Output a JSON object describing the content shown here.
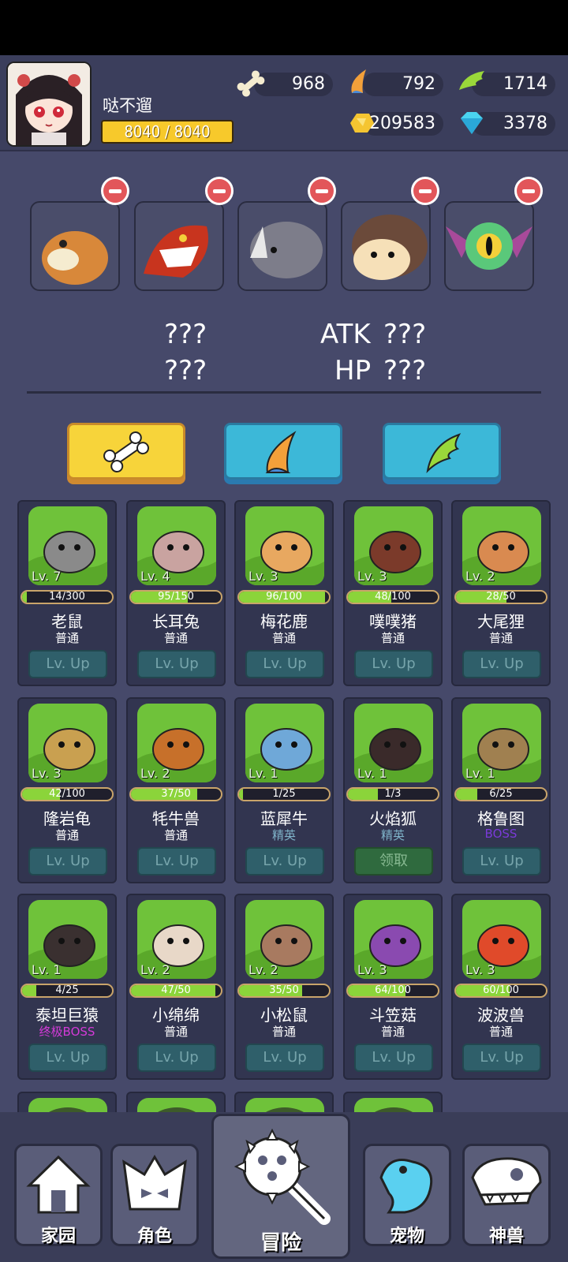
{
  "player": {
    "name": "哒不遛",
    "hp": "8040 / 8040"
  },
  "resources": [
    {
      "icon": "bone-icon",
      "value": "968"
    },
    {
      "icon": "horn-icon",
      "value": "792"
    },
    {
      "icon": "wing-icon",
      "value": "1714"
    },
    {
      "icon": "gold-icon",
      "value": "209583"
    },
    {
      "icon": "diamond-icon",
      "value": "3378"
    }
  ],
  "team": [
    "yak-pet",
    "dragon-pet",
    "rhino-pet",
    "hedgehog-pet",
    "eye-bat-pet"
  ],
  "stats": {
    "left1": "???",
    "left2": "???",
    "atk_label": "ATK",
    "atk": "???",
    "hp_label": "HP",
    "hp": "???"
  },
  "filter_tabs": [
    "bone-icon",
    "horn-icon",
    "wing-icon"
  ],
  "pets": [
    {
      "name": "老鼠",
      "rank": "普通",
      "level": "Lv. 7",
      "xp": "14/300",
      "fill": 0.05,
      "btn": "Lv. Up",
      "rank_color": "#ffffff",
      "bg": "#6fc23a",
      "body": "#8a8a8a"
    },
    {
      "name": "长耳兔",
      "rank": "普通",
      "level": "Lv. 4",
      "xp": "95/150",
      "fill": 0.63,
      "btn": "Lv. Up",
      "rank_color": "#ffffff",
      "bg": "#6fc23a",
      "body": "#c9a3a0"
    },
    {
      "name": "梅花鹿",
      "rank": "普通",
      "level": "Lv. 3",
      "xp": "96/100",
      "fill": 0.96,
      "btn": "Lv. Up",
      "rank_color": "#ffffff",
      "bg": "#6fc23a",
      "body": "#e8a860"
    },
    {
      "name": "噗噗猪",
      "rank": "普通",
      "level": "Lv. 3",
      "xp": "48/100",
      "fill": 0.48,
      "btn": "Lv. Up",
      "rank_color": "#ffffff",
      "bg": "#6fc23a",
      "body": "#7b3a2a"
    },
    {
      "name": "大尾狸",
      "rank": "普通",
      "level": "Lv. 2",
      "xp": "28/50",
      "fill": 0.56,
      "btn": "Lv. Up",
      "rank_color": "#ffffff",
      "bg": "#6fc23a",
      "body": "#d98a50"
    },
    {
      "name": "隆岩龟",
      "rank": "普通",
      "level": "Lv. 3",
      "xp": "42/100",
      "fill": 0.42,
      "btn": "Lv. Up",
      "rank_color": "#ffffff",
      "bg": "#6fc23a",
      "body": "#c9a050"
    },
    {
      "name": "牦牛兽",
      "rank": "普通",
      "level": "Lv. 2",
      "xp": "37/50",
      "fill": 0.74,
      "btn": "Lv. Up",
      "rank_color": "#ffffff",
      "bg": "#6fc23a",
      "body": "#c7702a"
    },
    {
      "name": "蓝犀牛",
      "rank": "精英",
      "level": "Lv. 1",
      "xp": "1/25",
      "fill": 0.04,
      "btn": "Lv. Up",
      "rank_color": "#7fb3c9",
      "bg": "#6fc23a",
      "body": "#6fa8d8"
    },
    {
      "name": "火焰狐",
      "rank": "精英",
      "level": "Lv. 1",
      "xp": "1/3",
      "fill": 0.33,
      "btn": "领取",
      "rank_color": "#7fb3c9",
      "bg": "#6fc23a",
      "body": "#3a2a2a"
    },
    {
      "name": "格鲁图",
      "rank": "BOSS",
      "level": "Lv. 1",
      "xp": "6/25",
      "fill": 0.24,
      "btn": "Lv. Up",
      "rank_color": "#7a3ad8",
      "bg": "#6fc23a",
      "body": "#a08050"
    },
    {
      "name": "泰坦巨猿",
      "rank": "终极BOSS",
      "level": "Lv. 1",
      "xp": "4/25",
      "fill": 0.16,
      "btn": "Lv. Up",
      "rank_color": "#d43ad8",
      "bg": "#6fc23a",
      "body": "#3a3030"
    },
    {
      "name": "小绵绵",
      "rank": "普通",
      "level": "Lv. 2",
      "xp": "47/50",
      "fill": 0.94,
      "btn": "Lv. Up",
      "rank_color": "#ffffff",
      "bg": "#6fc23a",
      "body": "#e8d8c8"
    },
    {
      "name": "小松鼠",
      "rank": "普通",
      "level": "Lv. 2",
      "xp": "35/50",
      "fill": 0.7,
      "btn": "Lv. Up",
      "rank_color": "#ffffff",
      "bg": "#6fc23a",
      "body": "#a87a60"
    },
    {
      "name": "斗笠菇",
      "rank": "普通",
      "level": "Lv. 3",
      "xp": "64/100",
      "fill": 0.64,
      "btn": "Lv. Up",
      "rank_color": "#ffffff",
      "bg": "#6fc23a",
      "body": "#8a4ab0"
    },
    {
      "name": "波波兽",
      "rank": "普通",
      "level": "Lv. 3",
      "xp": "60/100",
      "fill": 0.6,
      "btn": "Lv. Up",
      "rank_color": "#ffffff",
      "bg": "#6fc23a",
      "body": "#e04a2a"
    }
  ],
  "nav": [
    {
      "label": "家园",
      "icon": "home-icon"
    },
    {
      "label": "角色",
      "icon": "helmet-icon"
    },
    {
      "label": "冒险",
      "icon": "mace-icon"
    },
    {
      "label": "宠物",
      "icon": "frog-icon"
    },
    {
      "label": "神兽",
      "icon": "dino-skull-icon"
    }
  ]
}
